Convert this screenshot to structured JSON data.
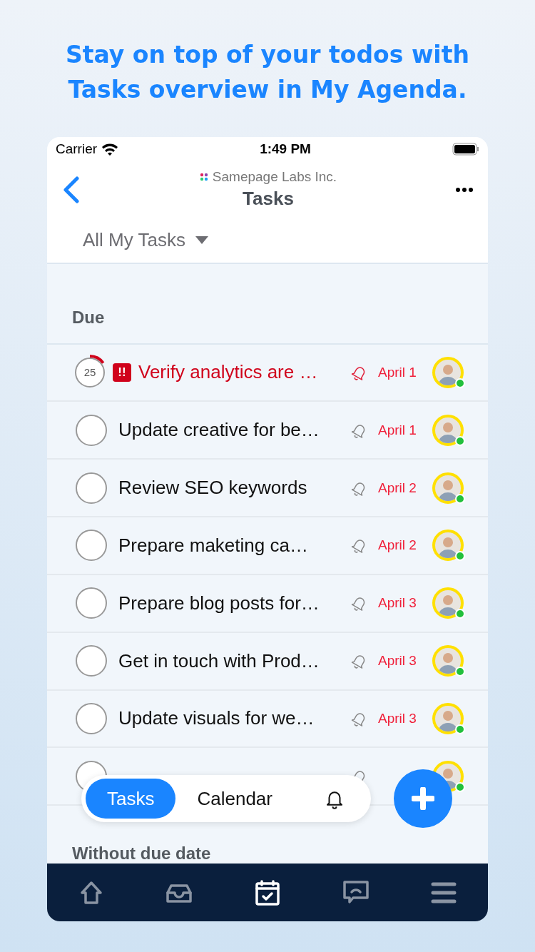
{
  "headline": "Stay on top of your todos with Tasks overview in My Agenda.",
  "status_bar": {
    "carrier": "Carrier",
    "time": "1:49 PM"
  },
  "header": {
    "workspace": "Samepage Labs Inc.",
    "title": "Tasks"
  },
  "filter": {
    "label": "All My Tasks"
  },
  "sections": [
    {
      "title": "Due",
      "tasks": [
        {
          "title": "Verify analytics are …",
          "date": "April 1",
          "urgent": true,
          "priority": "!!",
          "progress": "25",
          "level": 0.15
        },
        {
          "title": "Update creative for be…",
          "date": "April 1",
          "urgent": false,
          "checked": false
        },
        {
          "title": "Review SEO keywords",
          "date": "April 2",
          "urgent": false,
          "checked": false
        },
        {
          "title": "Prepare maketing ca…",
          "date": "April 2",
          "urgent": false,
          "checked": false
        },
        {
          "title": "Prepare blog posts for…",
          "date": "April 3",
          "urgent": false,
          "checked": false
        },
        {
          "title": "Get in touch with Prod…",
          "date": "April 3",
          "urgent": false,
          "checked": false
        },
        {
          "title": "Update visuals for we…",
          "date": "April 3",
          "urgent": false,
          "checked": false
        },
        {
          "urgent": false,
          "checked": false
        }
      ]
    },
    {
      "title": "Without due date"
    }
  ],
  "view_switch": [
    {
      "kind": "text",
      "label": "Tasks",
      "selected": true
    },
    {
      "kind": "text",
      "label": "Calendar",
      "selected": false
    },
    {
      "kind": "bell",
      "selected": false
    }
  ],
  "tab_bar": [
    {
      "kind": "home",
      "selected": false
    },
    {
      "kind": "inbox",
      "selected": false
    },
    {
      "kind": "calendar",
      "selected": true
    },
    {
      "kind": "chat",
      "selected": false
    },
    {
      "kind": "menu",
      "selected": false
    }
  ]
}
